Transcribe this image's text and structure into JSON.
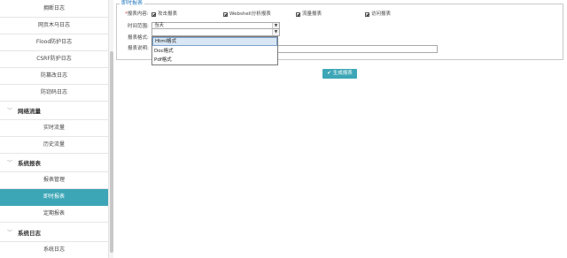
{
  "sidebar": {
    "items": [
      {
        "type": "item",
        "label": "拥断日志"
      },
      {
        "type": "item",
        "label": "网页木马日志"
      },
      {
        "type": "item",
        "label": "Flood防护日志"
      },
      {
        "type": "item",
        "label": "CSRF防护日志"
      },
      {
        "type": "item",
        "label": "防篡改日志"
      },
      {
        "type": "item",
        "label": "防窃码日志"
      },
      {
        "type": "group",
        "label": "网络流量"
      },
      {
        "type": "item",
        "label": "实时流量"
      },
      {
        "type": "item",
        "label": "历史流量"
      },
      {
        "type": "group",
        "label": "系统报表"
      },
      {
        "type": "item",
        "label": "报表管理"
      },
      {
        "type": "item",
        "label": "即时报表",
        "active": true
      },
      {
        "type": "item",
        "label": "定期报表"
      },
      {
        "type": "group",
        "label": "系统日志"
      },
      {
        "type": "item",
        "label": "系统日志"
      }
    ]
  },
  "form": {
    "legend": "即时报表",
    "content_label": "报表内容:",
    "required_mark": "*",
    "checkboxes": [
      {
        "label": "攻击报表",
        "checked": true
      },
      {
        "label": "Webshell分析报表",
        "checked": true
      },
      {
        "label": "流量报表",
        "checked": true
      },
      {
        "label": "访问报表",
        "checked": true
      }
    ],
    "time_range_label": "时间范围:",
    "time_range_value": "当天",
    "format_label": "报表格式:",
    "format_value": "",
    "desc_label": "报表说明:",
    "format_options": [
      "Html格式",
      "Doc格式",
      "Pdf格式"
    ],
    "format_highlighted": "Html格式",
    "generate_button": "生成报表"
  },
  "icons": {
    "expand": "chevron-down-icon",
    "generate": "check-icon"
  },
  "colors": {
    "accent": "#3da6b6",
    "legend": "#2b7bbf",
    "required": "#d9362b"
  }
}
